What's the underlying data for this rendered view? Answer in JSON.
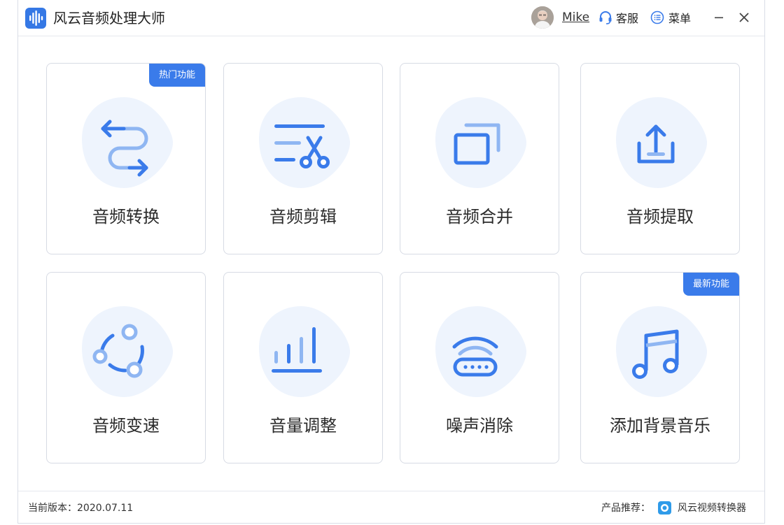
{
  "app": {
    "title": "风云音频处理大师",
    "brand_color": "#3578e5"
  },
  "header": {
    "username": "Mike",
    "support_label": "客服",
    "menu_label": "菜单"
  },
  "cards": [
    {
      "label": "音频转换",
      "icon": "convert-arrows-icon",
      "badge": "热门功能"
    },
    {
      "label": "音频剪辑",
      "icon": "scissors-icon",
      "badge": ""
    },
    {
      "label": "音频合并",
      "icon": "merge-windows-icon",
      "badge": ""
    },
    {
      "label": "音频提取",
      "icon": "upload-tray-icon",
      "badge": ""
    },
    {
      "label": "音频变速",
      "icon": "speed-cycle-icon",
      "badge": ""
    },
    {
      "label": "音量调整",
      "icon": "volume-bars-icon",
      "badge": ""
    },
    {
      "label": "噪声消除",
      "icon": "wifi-router-icon",
      "badge": ""
    },
    {
      "label": "添加背景音乐",
      "icon": "music-note-icon",
      "badge": "最新功能"
    }
  ],
  "footer": {
    "version_text": "当前版本：2020.07.11",
    "recommend_label": "产品推荐：",
    "recommend_app": "风云视频转换器"
  },
  "colors": {
    "accent": "#3a7bea",
    "icon_bg": "#eef4fd",
    "icon_light": "#8fb6f2",
    "icon_dark": "#3a7bea"
  }
}
